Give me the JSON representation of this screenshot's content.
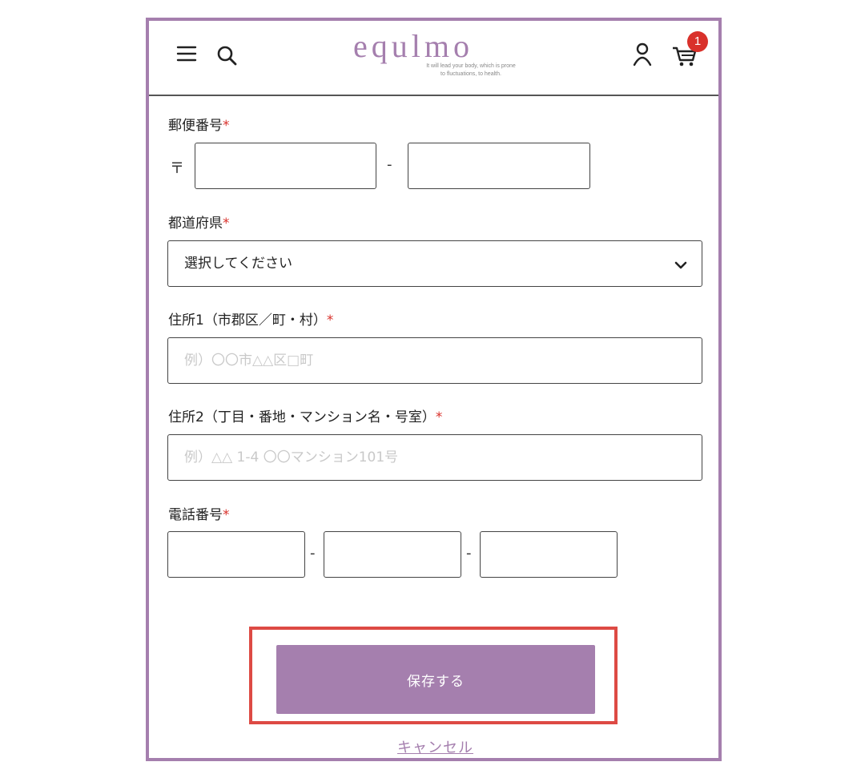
{
  "header": {
    "logo": "equlmo",
    "tagline_line1": "It will lead your body, which is prone",
    "tagline_line2": "to fluctuations, to health.",
    "cart_count": "1",
    "icons": {
      "menu": "menu-icon",
      "search": "search-icon",
      "user": "user-icon",
      "cart": "cart-icon"
    }
  },
  "form": {
    "postal": {
      "label": "郵便番号",
      "required": "*",
      "mark": "〒",
      "separator": "-",
      "value1": "",
      "value2": ""
    },
    "prefecture": {
      "label": "都道府県",
      "required": "*",
      "selected": "選択してください"
    },
    "address1": {
      "label": "住所1（市郡区／町・村）",
      "required": "*",
      "placeholder": "例）〇〇市△△区□町",
      "value": ""
    },
    "address2": {
      "label": "住所2（丁目・番地・マンション名・号室）",
      "required": "*",
      "placeholder": "例）△△ 1-4 〇〇マンション101号",
      "value": ""
    },
    "phone": {
      "label": "電話番号",
      "required": "*",
      "separator": "-",
      "value1": "",
      "value2": "",
      "value3": ""
    }
  },
  "actions": {
    "save_label": "保存する",
    "cancel_label": "キャンセル"
  },
  "colors": {
    "accent": "#a57fae",
    "required": "#d9312b",
    "highlight": "#dd4a44",
    "badge": "#d9312b"
  }
}
